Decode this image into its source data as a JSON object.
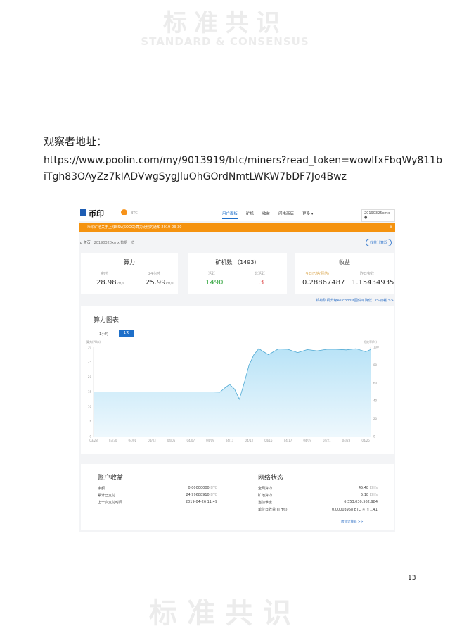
{
  "watermark_top": {
    "cn": "标准共识",
    "en": "STANDARD & CONSENSUS"
  },
  "watermark_bottom": {
    "cn": "标准共识"
  },
  "label": "观察者地址：",
  "url_line1": "https://www.poolin.com/my/9013919/btc/miners?read_token=wowIfxFbqWy811b",
  "url_line2": "iTgh83OAyZz7kIADVwgSygJluOhGOrdNmtLWKW7bDF7Jo4Bwz",
  "page_number": "13",
  "app": {
    "logo": "币印",
    "coin": "BTC",
    "nav": [
      "用户面板",
      "矿机",
      "收益",
      "闪电商店",
      "更多 ▾"
    ],
    "account": "20190325xmx",
    "banner": "币印矿池关于上线BSV(SOOO)算力比例的通知  2019-03-30",
    "breadcrumb": {
      "home": "首页",
      "current": "20190320xmx 数据一览"
    },
    "calc_button": "收益计算器",
    "hashrate": {
      "title": "算力",
      "realtime_label": "实时",
      "realtime": "28.98",
      "unit": "PH/s",
      "day_label": "24小时",
      "day": "25.99"
    },
    "miners": {
      "title": "矿机数 （1493）",
      "active_label": "活跃",
      "active": "1490",
      "inactive_label": "非活跃",
      "inactive": "3"
    },
    "earnings": {
      "title": "收益",
      "today_label": "今日已挖(预估)",
      "today": "0.28867487",
      "yesterday_label": "昨日实收",
      "yesterday": "1.15434935"
    },
    "asicboost_link": "蚂蚁矿机升级AsicBoost固件可降低13%功耗 >>",
    "account_income": {
      "title": "账户收益",
      "rows": [
        [
          "余额",
          "0.00000000",
          "BTC"
        ],
        [
          "累计已支付",
          "24.99688910",
          "BTC"
        ],
        [
          "上一次支付时间",
          "2019-04-26 11:49",
          ""
        ]
      ]
    },
    "network": {
      "title": "网络状态",
      "rows": [
        [
          "全网算力",
          "45.48",
          "EH/s"
        ],
        [
          "矿池算力",
          "5.18",
          "EH/s"
        ],
        [
          "当前难度",
          "6,353,030,562,984",
          ""
        ],
        [
          "单位日收益 (TH/s)",
          "0.00003958 BTC ≈ ￥1.41",
          ""
        ]
      ],
      "link": "收益计算器 >>"
    }
  },
  "chart_data": {
    "type": "area",
    "title": "算力图表",
    "tabs": [
      "1小时",
      "1天"
    ],
    "active_tab": "1天",
    "ylabel": "算力(PH/s)",
    "ylabel_right": "拒绝率(%)",
    "ylim": [
      0,
      30
    ],
    "yticks": [
      0,
      5,
      10,
      15,
      20,
      25,
      30
    ],
    "yticks_right": [
      0,
      20,
      40,
      60,
      80,
      100
    ],
    "xticks": [
      "03/28",
      "03/30",
      "04/01",
      "04/03",
      "04/05",
      "04/07",
      "04/09",
      "04/11",
      "04/13",
      "04/15",
      "04/17",
      "04/19",
      "04/21",
      "04/23",
      "04/25"
    ],
    "x": [
      0,
      1,
      2,
      3,
      4,
      5,
      6,
      7,
      8,
      9,
      10,
      11,
      12,
      13,
      13.5,
      14,
      14.5,
      15,
      15.5,
      16,
      16.5,
      17,
      18,
      19,
      20,
      21,
      22,
      23,
      24,
      25,
      26,
      27,
      28,
      28.5
    ],
    "values": [
      15,
      15,
      15,
      15,
      15,
      15,
      15,
      15,
      15,
      15,
      15,
      15,
      15,
      14.9,
      16.3,
      17.5,
      16,
      12.5,
      18,
      24,
      27.5,
      29.5,
      27.5,
      29.4,
      29.3,
      28.2,
      29.2,
      28.8,
      29.3,
      29.3,
      29.1,
      29.5,
      28.5,
      29.2
    ]
  }
}
